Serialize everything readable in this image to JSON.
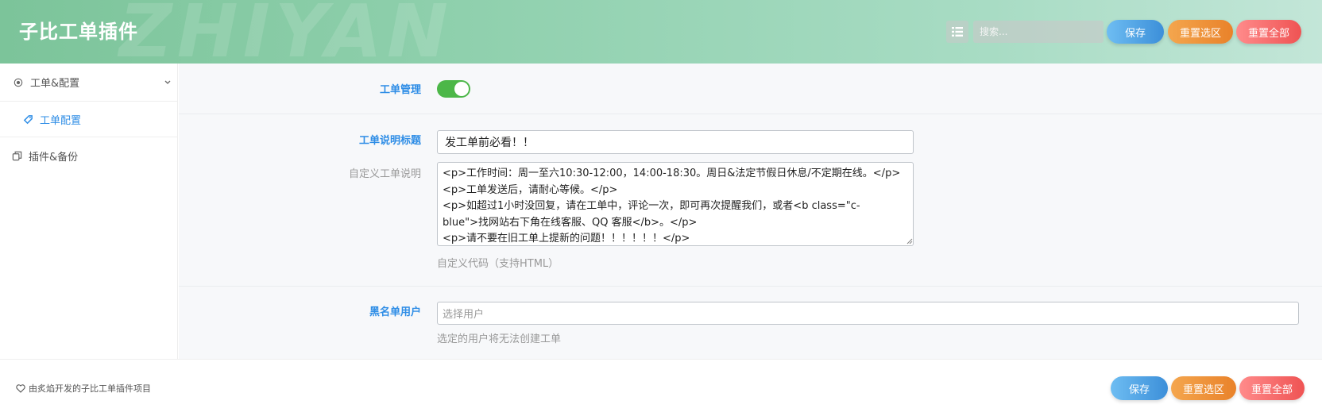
{
  "header": {
    "title": "子比工单插件",
    "watermark": "ZHIYAN",
    "list_icon": "list-icon",
    "search_placeholder": "搜索...",
    "buttons": {
      "save": "保存",
      "reset_selected": "重置选区",
      "reset_all": "重置全部"
    }
  },
  "sidebar": {
    "items": [
      {
        "label": "工单&配置",
        "icon": "target-icon"
      },
      {
        "label": "工单配置",
        "icon": "tag-icon",
        "active": true
      },
      {
        "label": "插件&备份",
        "icon": "copy-icon"
      }
    ]
  },
  "form": {
    "ticket_mgmt": {
      "label": "工单管理",
      "enabled": true
    },
    "desc_title": {
      "label": "工单说明标题",
      "value": "发工单前必看！！"
    },
    "custom_desc": {
      "label": "自定义工单说明",
      "lines": [
        "<p>工作时间：周一至六10:30-12:00，14:00-18:30。周日&法定节假日休息/不定期在线。</p>",
        "<p>工单发送后，请耐心等候。</p>",
        "<p>如超过1小时没回复，请在工单中，评论一次，即可再次提醒我们，或者<b class=\"c-",
        "blue\">找网站右下角在线客服、QQ 客服</b>。</p>",
        "<p>请不要在旧工单上提新的问题！！！！！！</p>"
      ],
      "hint": "自定义代码（支持HTML）"
    },
    "blacklist": {
      "label": "黑名单用户",
      "placeholder": "选择用户",
      "hint": "选定的用户将无法创建工单"
    }
  },
  "footer": {
    "credit": "由炙焰开发的子比工单插件项目",
    "buttons": {
      "save": "保存",
      "reset_selected": "重置选区",
      "reset_all": "重置全部"
    }
  },
  "colors": {
    "accent": "#2e8de6",
    "toggle_on": "#4cb748",
    "save": "#3c8fd9",
    "reset_selected": "#e9822a",
    "reset_all": "#ef5353"
  }
}
